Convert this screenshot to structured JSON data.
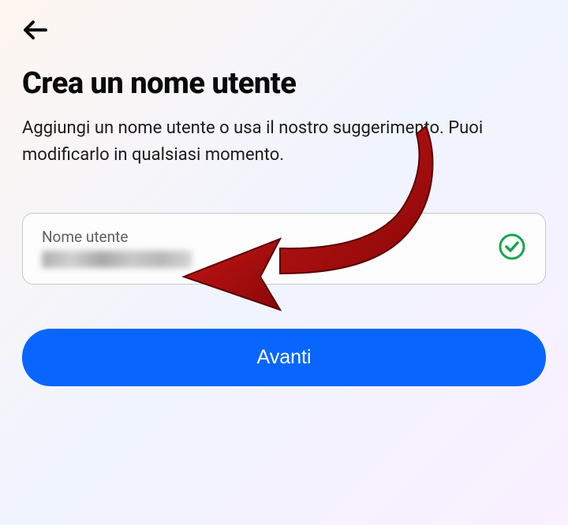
{
  "header": {
    "title": "Crea un nome utente",
    "subtitle": "Aggiungi un nome utente o usa il nostro suggerimento. Puoi modificarlo in qualsiasi momento."
  },
  "input": {
    "label": "Nome utente",
    "value": ""
  },
  "actions": {
    "primary_button_label": "Avanti"
  },
  "colors": {
    "primary": "#0866ff",
    "success": "#18a54a",
    "text": "#0a0a0a",
    "annotation": "#b01010"
  },
  "icons": {
    "back": "arrow-left-icon",
    "validation": "check-circle-icon",
    "annotation": "curved-arrow-icon"
  }
}
